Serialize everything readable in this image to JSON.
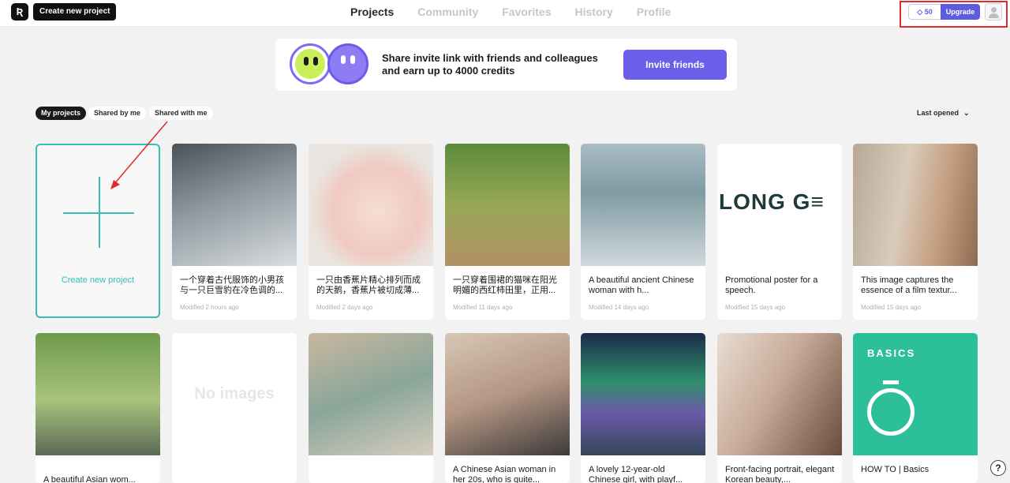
{
  "header": {
    "create_button": "Create new project",
    "nav": [
      "Projects",
      "Community",
      "Favorites",
      "History",
      "Profile"
    ],
    "credits": "50",
    "upgrade": "Upgrade"
  },
  "banner": {
    "text": "Share invite link with friends and colleagues and earn up to 4000 credits",
    "invite_button": "Invite friends"
  },
  "filters": [
    "My projects",
    "Shared by me",
    "Shared with me"
  ],
  "sort_label": "Last opened",
  "create_card_label": "Create new project",
  "projects": [
    {
      "title": "一个穿着古代服饰的小男孩与一只巨雪豹在冷色调的...",
      "meta": "Modified 2 hours ago"
    },
    {
      "title": "一只由香蕉片精心排列而成的天鹅，香蕉片被切成薄...",
      "meta": "Modified 2 days ago"
    },
    {
      "title": "一只穿着围裙的猫咪在阳光明媚的西红柿田里，正用...",
      "meta": "Modified 11 days ago"
    },
    {
      "title": "A beautiful ancient Chinese woman with h...",
      "meta": "Modified 14 days ago"
    },
    {
      "title": "Promotional poster for a speech.",
      "meta": "Modified 15 days ago"
    },
    {
      "title": "This image captures the essence of a film textur...",
      "meta": "Modified 15 days ago"
    },
    {
      "title": "A beautiful Asian wom...",
      "meta": ""
    },
    {
      "title": "",
      "meta": ""
    },
    {
      "title": "",
      "meta": ""
    },
    {
      "title": "A Chinese Asian woman in her 20s, who is quite...",
      "meta": ""
    },
    {
      "title": "A lovely 12-year-old Chinese girl, with playf...",
      "meta": ""
    },
    {
      "title": "Front-facing portrait, elegant Korean beauty,...",
      "meta": ""
    },
    {
      "title": "HOW TO | Basics",
      "meta": ""
    }
  ],
  "thumb_text": {
    "longge": "LONG G≡",
    "no_images": "No images",
    "basics": "BASICS"
  },
  "colors": {
    "accent": "#35c0b2",
    "brand": "#5b5ce0",
    "highlight": "#e32b2b"
  }
}
